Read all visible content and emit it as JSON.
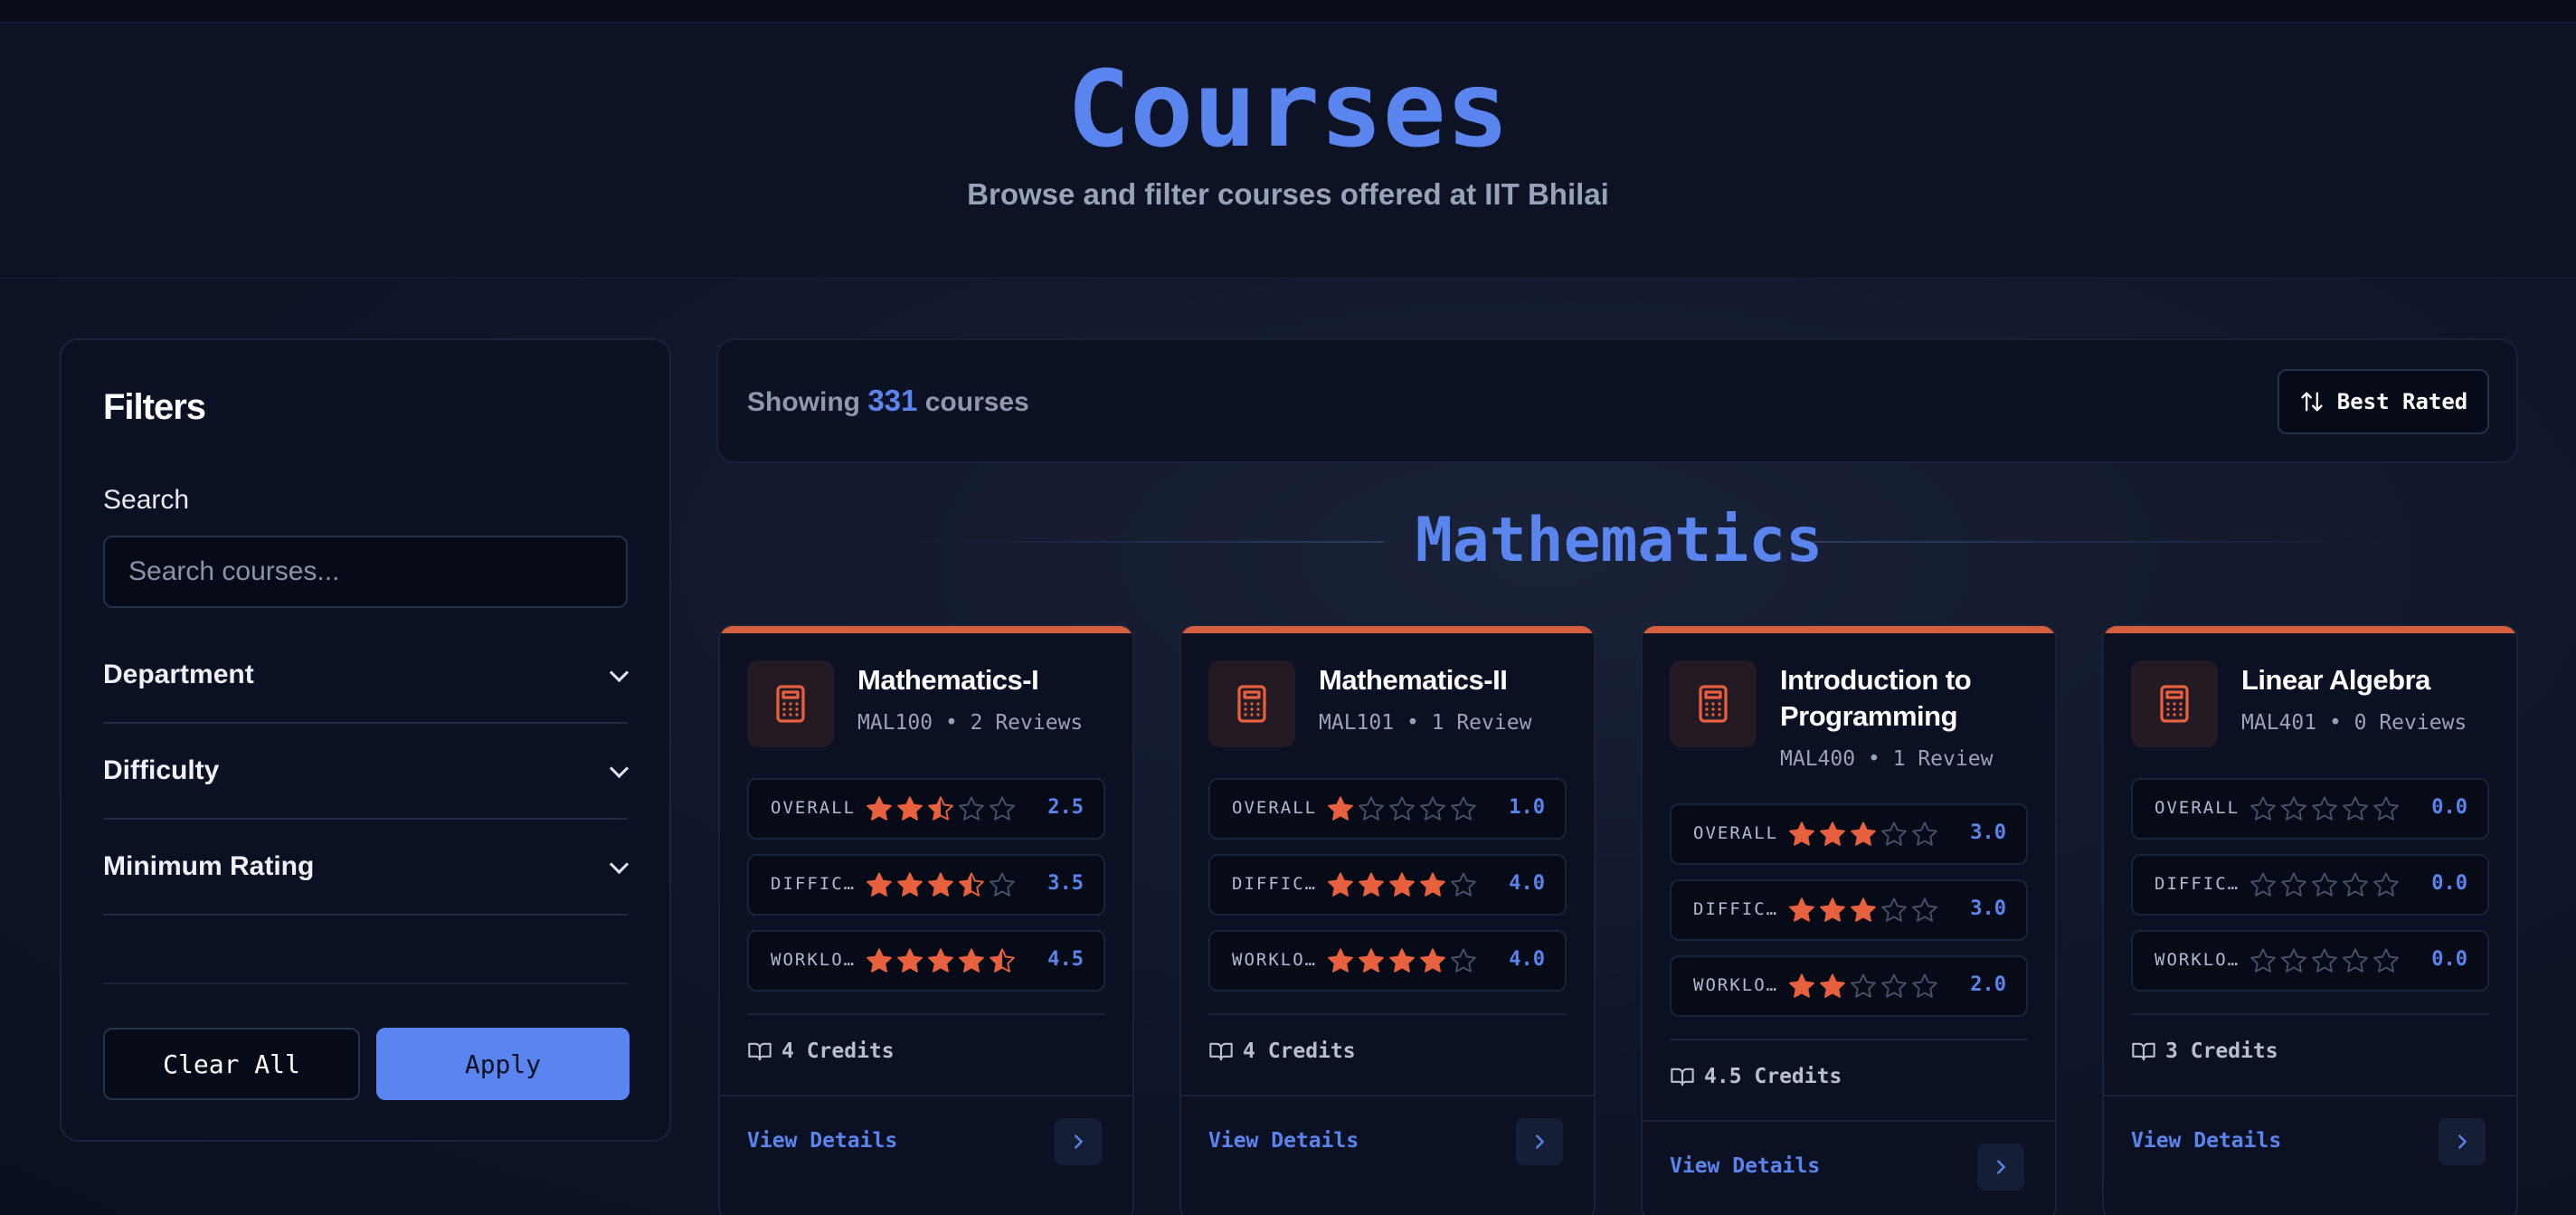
{
  "header": {
    "title": "Courses",
    "subtitle": "Browse and filter courses offered at IIT Bhilai"
  },
  "filters": {
    "title": "Filters",
    "search_label": "Search",
    "search_placeholder": "Search courses...",
    "sections": [
      "Department",
      "Difficulty",
      "Minimum Rating"
    ],
    "clear_label": "Clear All",
    "apply_label": "Apply"
  },
  "results": {
    "showing_prefix": "Showing",
    "count": "331",
    "showing_suffix": "courses",
    "sort_label": "Best Rated"
  },
  "section_title": "Mathematics",
  "accent_color": "#5b85ee",
  "star_color": "#e8613f",
  "courses": [
    {
      "title": "Mathematics-I",
      "code": "MAL100",
      "reviews": "2 Reviews",
      "ratings": [
        {
          "label": "OVERALL",
          "value": "2.5",
          "stars": 2.5
        },
        {
          "label": "DIFFICULTY",
          "value": "3.5",
          "stars": 3.5
        },
        {
          "label": "WORKLOAD",
          "value": "4.5",
          "stars": 4.5
        }
      ],
      "credits": "4 Credits",
      "view_label": "View Details"
    },
    {
      "title": "Mathematics-II",
      "code": "MAL101",
      "reviews": "1 Review",
      "ratings": [
        {
          "label": "OVERALL",
          "value": "1.0",
          "stars": 1
        },
        {
          "label": "DIFFICULTY",
          "value": "4.0",
          "stars": 4
        },
        {
          "label": "WORKLOAD",
          "value": "4.0",
          "stars": 4
        }
      ],
      "credits": "4 Credits",
      "view_label": "View Details"
    },
    {
      "title": "Introduction to Programming",
      "code": "MAL400",
      "reviews": "1 Review",
      "ratings": [
        {
          "label": "OVERALL",
          "value": "3.0",
          "stars": 3
        },
        {
          "label": "DIFFICULTY",
          "value": "3.0",
          "stars": 3
        },
        {
          "label": "WORKLOAD",
          "value": "2.0",
          "stars": 2
        }
      ],
      "credits": "4.5 Credits",
      "view_label": "View Details"
    },
    {
      "title": "Linear Algebra",
      "code": "MAL401",
      "reviews": "0 Reviews",
      "ratings": [
        {
          "label": "OVERALL",
          "value": "0.0",
          "stars": 0
        },
        {
          "label": "DIFFICULTY",
          "value": "0.0",
          "stars": 0
        },
        {
          "label": "WORKLOAD",
          "value": "0.0",
          "stars": 0
        }
      ],
      "credits": "3 Credits",
      "view_label": "View Details"
    }
  ]
}
